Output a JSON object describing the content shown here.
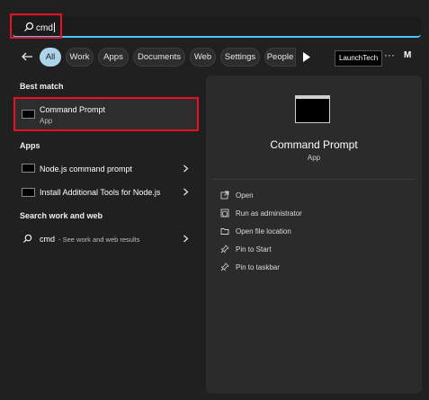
{
  "search": {
    "query": "cmd",
    "icon": "search-icon"
  },
  "filters": {
    "chips": [
      "All",
      "Work",
      "Apps",
      "Documents",
      "Web",
      "Settings",
      "People"
    ],
    "active": "All",
    "org_badge": "LaunchTech",
    "more": "···",
    "avatar_initial": "M"
  },
  "left": {
    "best_match_header": "Best match",
    "best_match": {
      "title": "Command Prompt",
      "subtitle": "App",
      "icon": "cmd-icon"
    },
    "apps_header": "Apps",
    "apps": [
      {
        "label": "Node.js command prompt",
        "icon": "cmd-icon"
      },
      {
        "label": "Install Additional Tools for Node.js",
        "icon": "cmd-icon"
      }
    ],
    "web_header": "Search work and web",
    "web": {
      "query": "cmd",
      "suffix": "- See work and web results",
      "icon": "search-icon"
    }
  },
  "detail": {
    "title": "Command Prompt",
    "subtitle": "App",
    "actions": [
      {
        "label": "Open",
        "icon": "open-icon"
      },
      {
        "label": "Run as administrator",
        "icon": "shield-icon"
      },
      {
        "label": "Open file location",
        "icon": "folder-icon"
      },
      {
        "label": "Pin to Start",
        "icon": "pin-icon"
      },
      {
        "label": "Pin to taskbar",
        "icon": "pin-icon"
      }
    ]
  },
  "colors": {
    "highlight": "#e81123",
    "accent": "#4cc2ff",
    "active_chip": "#aed3ea"
  }
}
